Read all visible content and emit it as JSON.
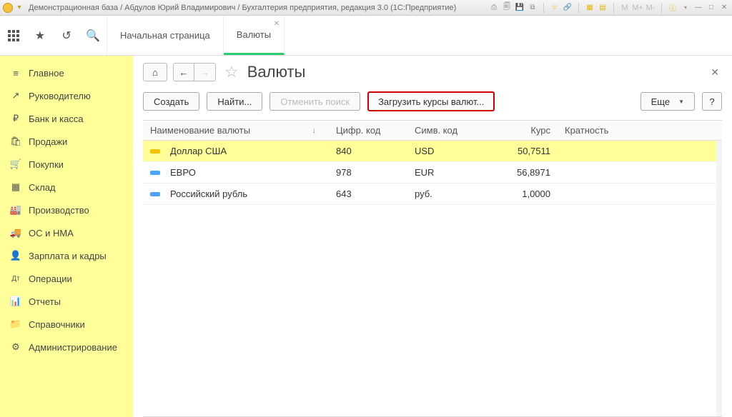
{
  "titlebar": {
    "text": "Демонстрационная база / Абдулов Юрий Владимирович / Бухгалтерия предприятия, редакция 3.0  (1С:Предприятие)",
    "calc_labels": [
      "M",
      "M+",
      "M-"
    ]
  },
  "tabs": {
    "start": "Начальная страница",
    "active": "Валюты"
  },
  "sidebar": {
    "items": [
      {
        "icon": "≡",
        "label": "Главное"
      },
      {
        "icon": "↗",
        "label": "Руководителю"
      },
      {
        "icon": "₽",
        "label": "Банк и касса"
      },
      {
        "icon": "🛍",
        "label": "Продажи"
      },
      {
        "icon": "🛒",
        "label": "Покупки"
      },
      {
        "icon": "▦",
        "label": "Склад"
      },
      {
        "icon": "🏭",
        "label": "Производство"
      },
      {
        "icon": "🚚",
        "label": "ОС и НМА"
      },
      {
        "icon": "👤",
        "label": "Зарплата и кадры"
      },
      {
        "icon": "Дт",
        "label": "Операции"
      },
      {
        "icon": "📊",
        "label": "Отчеты"
      },
      {
        "icon": "📁",
        "label": "Справочники"
      },
      {
        "icon": "⚙",
        "label": "Администрирование"
      }
    ]
  },
  "page": {
    "title": "Валюты"
  },
  "toolbar": {
    "create": "Создать",
    "find": "Найти...",
    "cancel_find": "Отменить поиск",
    "load_rates": "Загрузить курсы валют...",
    "more": "Еще",
    "help": "?"
  },
  "grid": {
    "columns": {
      "name": "Наименование валюты",
      "ncode": "Цифр. код",
      "scode": "Симв. код",
      "rate": "Курс",
      "mult": "Кратность"
    },
    "rows": [
      {
        "mark": "y",
        "name": "Доллар США",
        "ncode": "840",
        "scode": "USD",
        "rate": "50,7511",
        "sel": true
      },
      {
        "mark": "b",
        "name": "ЕВРО",
        "ncode": "978",
        "scode": "EUR",
        "rate": "56,8971",
        "sel": false
      },
      {
        "mark": "b",
        "name": "Российский рубль",
        "ncode": "643",
        "scode": "руб.",
        "rate": "1,0000",
        "sel": false
      }
    ]
  }
}
